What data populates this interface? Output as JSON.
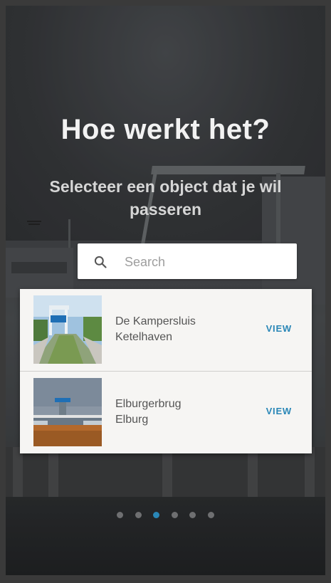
{
  "header": {
    "title": "Hoe werkt het?",
    "subtitle": "Selecteer een object dat je wil passeren"
  },
  "search": {
    "placeholder": "Search",
    "value": ""
  },
  "results": [
    {
      "name": "De Kampersluis",
      "place": "Ketelhaven",
      "action": "VIEW"
    },
    {
      "name": "Elburgerbrug",
      "place": "Elburg",
      "action": "VIEW"
    }
  ],
  "pager": {
    "count": 6,
    "active_index": 2
  },
  "colors": {
    "accent": "#2a87b7",
    "title": "#f2f2f2",
    "card": "#f6f5f3"
  }
}
